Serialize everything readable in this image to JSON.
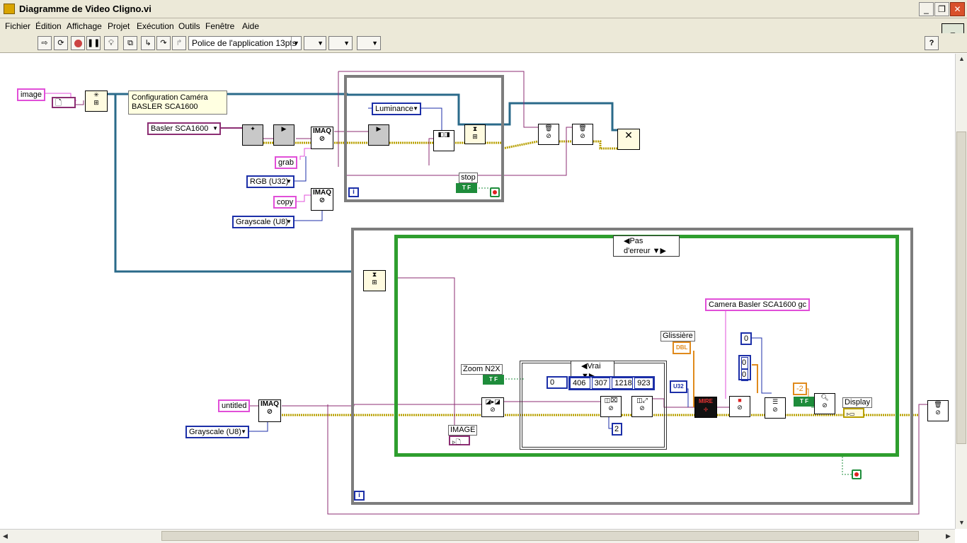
{
  "window": {
    "title": "Diagramme de Video Cligno.vi",
    "controls": [
      "_",
      "❐",
      "✕"
    ]
  },
  "menu": [
    "Fichier",
    "Édition",
    "Affichage",
    "Projet",
    "Exécution",
    "Outils",
    "Fenêtre",
    "Aide"
  ],
  "toolbar": {
    "font": "Police de l'application 13pts",
    "help": "?",
    "buttons": [
      "run-arrow-icon",
      "run-continuous-icon",
      "abort-icon",
      "pause-icon",
      "highlight-execution-icon",
      "retain-wire-values-icon",
      "step-into-icon",
      "step-over-icon",
      "step-out-icon",
      "align-icon",
      "distribute-icon",
      "reorder-icon"
    ]
  },
  "diagram": {
    "constants": {
      "image": "image",
      "camera": "Basler SCA1600",
      "grab": "grab",
      "rgb": "RGB (U32)",
      "copy": "copy",
      "grayscale1": "Grayscale (U8)",
      "luminance": "Luminance",
      "untitled": "untitled",
      "grayscale2": "Grayscale (U8)",
      "camera_config": "Camera Basler SCA1600 gc",
      "neg2": "-2",
      "zero_a": "0",
      "zero_b": "0",
      "zero_c": "0",
      "two": "2",
      "u32": "U32",
      "dbl": "DBL",
      "rect_label": "0",
      "rect": [
        "406",
        "307",
        "1218",
        "923"
      ]
    },
    "note": "Configuration Caméra\nBASLER SCA1600",
    "labels": {
      "stop": "stop",
      "zoom": "Zoom N2X",
      "image_ind": "IMAGE",
      "glissiere": "Glissière",
      "display": "Display",
      "imaq": "IMAQ",
      "tf": "T F",
      "mire": "MIRE"
    },
    "case_selectors": {
      "outer": "Pas d'erreur",
      "inner": "Vrai"
    },
    "loop_index": "i"
  },
  "colors": {
    "pink_wire": "#e14fd8",
    "purple_wire": "#8c2e73",
    "blue_wire": "#1c2fa8",
    "teal_wire": "#2a6a8a",
    "error_wire": "#b8a000",
    "loop_frame": "#7d7d7d",
    "case_frame": "#2e9e2e"
  }
}
